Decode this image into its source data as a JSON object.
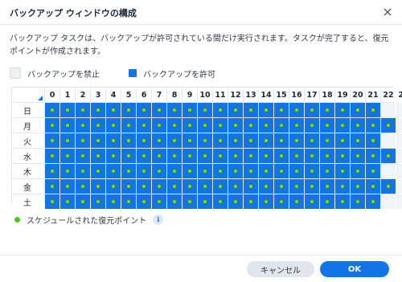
{
  "dialog": {
    "title": "バックアップ ウィンドウの構成",
    "description": "バックアップ タスクは、バックアップが許可されている間だけ実行されます。タスクが完了すると、復元ポイントが作成されます。"
  },
  "legend": {
    "deny_label": "バックアップを禁止",
    "allow_label": "バックアップを許可"
  },
  "schedule": {
    "hours": [
      "0",
      "1",
      "2",
      "3",
      "4",
      "5",
      "6",
      "7",
      "8",
      "9",
      "10",
      "11",
      "12",
      "13",
      "14",
      "15",
      "16",
      "17",
      "18",
      "19",
      "20",
      "21",
      "22",
      "23"
    ],
    "days": [
      {
        "label": "日",
        "allowed_until_hour": 21,
        "restore_point_until_hour": 21
      },
      {
        "label": "月",
        "allowed_until_hour": 22,
        "restore_point_until_hour": 22
      },
      {
        "label": "火",
        "allowed_until_hour": 21,
        "restore_point_until_hour": 21
      },
      {
        "label": "水",
        "allowed_until_hour": 22,
        "restore_point_until_hour": 22
      },
      {
        "label": "木",
        "allowed_until_hour": 21,
        "restore_point_until_hour": 21
      },
      {
        "label": "金",
        "allowed_until_hour": 22,
        "restore_point_until_hour": 22
      },
      {
        "label": "土",
        "allowed_until_hour": 21,
        "restore_point_until_hour": 21
      }
    ]
  },
  "snapshot_legend": {
    "label": "スケジュールされた復元ポイント",
    "info_icon": "info-icon"
  },
  "buttons": {
    "cancel": "キャンセル",
    "ok": "OK"
  },
  "colors": {
    "allowed": "#1274e6",
    "denied": "#f1f3f6",
    "restore_point": "#7fd24a",
    "accent": "#1274e6"
  }
}
